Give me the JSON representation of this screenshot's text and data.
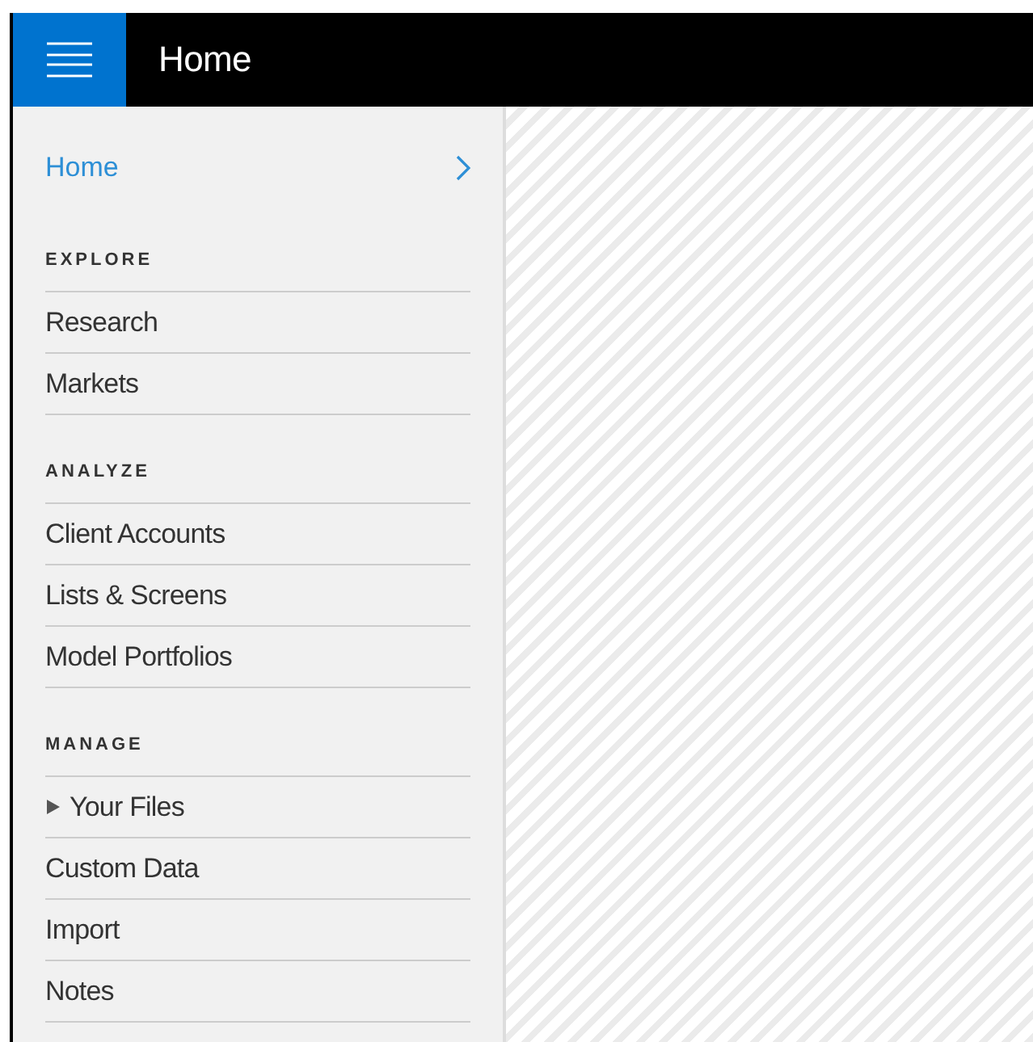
{
  "header": {
    "title": "Home"
  },
  "sidebar": {
    "home": {
      "label": "Home",
      "selected": true
    },
    "sections": [
      {
        "heading": "EXPLORE",
        "items": [
          {
            "label": "Research",
            "selected": false
          },
          {
            "label": "Markets",
            "selected": false
          }
        ]
      },
      {
        "heading": "ANALYZE",
        "items": [
          {
            "label": "Client Accounts",
            "selected": false
          },
          {
            "label": "Lists & Screens",
            "selected": false
          },
          {
            "label": "Model Portfolios",
            "selected": false
          }
        ]
      },
      {
        "heading": "MANAGE",
        "items": [
          {
            "label": "Your Files",
            "selected": false,
            "kind": "folder",
            "expanded": false
          },
          {
            "label": "Custom Data",
            "selected": false
          },
          {
            "label": "Import",
            "selected": false
          },
          {
            "label": "Notes",
            "selected": false
          }
        ]
      }
    ]
  }
}
